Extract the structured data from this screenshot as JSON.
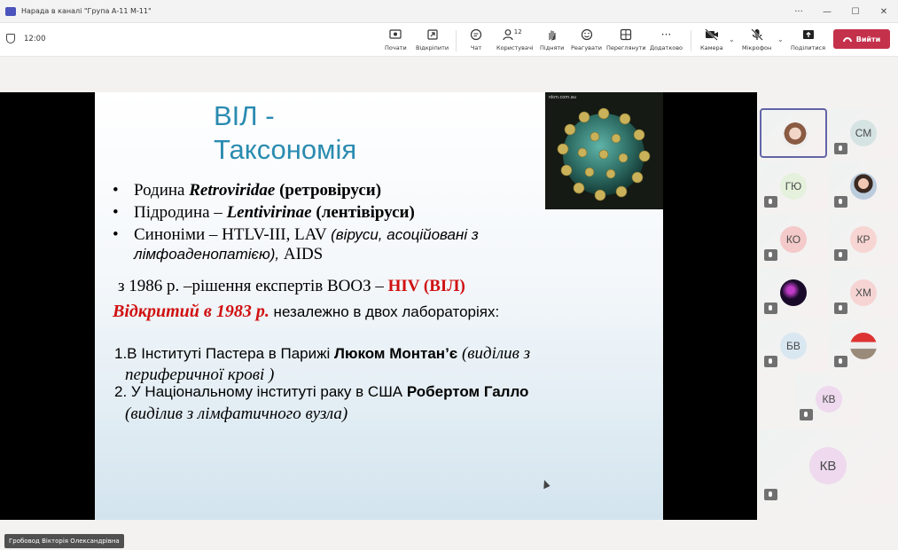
{
  "window": {
    "title": "Нарада в каналі \"Група А-11 М-11\"",
    "controls": [
      "···",
      "—",
      "☐",
      "✕"
    ]
  },
  "toolbar": {
    "timer": "12:00",
    "buttons": [
      {
        "label": "Почати",
        "icon": "record-icon"
      },
      {
        "label": "Відкріпити",
        "icon": "unpin-icon"
      },
      {
        "label": "Чат",
        "icon": "chat-icon"
      },
      {
        "label": "Користувачі",
        "icon": "people-icon",
        "count": "12"
      },
      {
        "label": "Підняти",
        "icon": "raise-hand-icon"
      },
      {
        "label": "Реагувати",
        "icon": "react-icon"
      },
      {
        "label": "Переглянути",
        "icon": "view-icon"
      },
      {
        "label": "Додатково",
        "icon": "more-icon"
      },
      {
        "label": "Камера",
        "icon": "camera-off-icon"
      },
      {
        "label": "Мікрофон",
        "icon": "mic-off-icon"
      },
      {
        "label": "Поділитися",
        "icon": "share-icon"
      }
    ],
    "leave_label": "Вийти"
  },
  "slide": {
    "title_line1": "ВІЛ -",
    "title_line2": "Таксономія",
    "image_source": "nkm.com.au",
    "bullet1_prefix": "Родина ",
    "bullet1_bold": "Retroviridae",
    "bullet1_suffix": " (ретровіруси)",
    "bullet2_prefix": "Підродина – ",
    "bullet2_bold": "Lentivirinae",
    "bullet2_suffix": " (лентівіруси)",
    "bullet3_prefix": "Синоніми – HTLV-III, LAV ",
    "bullet3_italic1": "(віруси, асоційовані з",
    "bullet3_italic2": "лімфоаденопатією),",
    "bullet3_suffix": "  AIDS",
    "line_1986": "з 1986 р. –рішення експертів ВООЗ – ",
    "line_1986_red": "HIV (ВІЛ)",
    "line_1983_red": "Відкритий в 1983 р.",
    "line_1983_rest": " незалежно в двох лабораторіях:",
    "lab1_prefix": "1.В Інституті Пастера в Парижі ",
    "lab1_bold": "Люком Монтан’є",
    "lab1_italic": " (виділив з",
    "lab1_cont": "периферичної крові )",
    "lab2_prefix": "2.     У Національному інституті раку в США ",
    "lab2_bold": "Робертом Галло",
    "lab2_cont": "(виділив з лімфатичного вузла)"
  },
  "gallery": {
    "participants": [
      {
        "initials": ""
      },
      {
        "initials": "СМ"
      },
      {
        "initials": "ГЮ"
      },
      {
        "initials": ""
      },
      {
        "initials": "КО"
      },
      {
        "initials": "КР"
      },
      {
        "initials": ""
      },
      {
        "initials": "ХМ"
      },
      {
        "initials": "БВ"
      },
      {
        "initials": ""
      },
      {
        "initials": "КВ"
      }
    ],
    "large_initials": "КВ"
  },
  "presenter_name": "Гробовод Вікторія Олександрівна"
}
